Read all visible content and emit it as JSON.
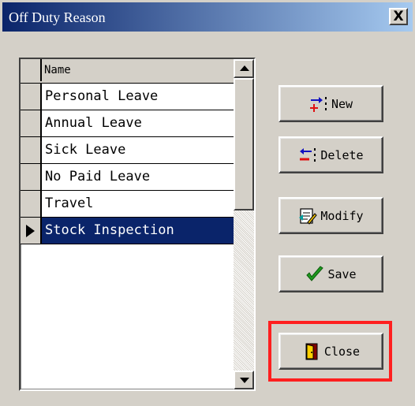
{
  "window": {
    "title": "Off Duty Reason",
    "close_glyph": "X"
  },
  "grid": {
    "column_header": "Name",
    "rows": [
      {
        "label": "Personal Leave",
        "selected": false
      },
      {
        "label": "Annual Leave",
        "selected": false
      },
      {
        "label": "Sick Leave",
        "selected": false
      },
      {
        "label": "No Paid Leave",
        "selected": false
      },
      {
        "label": "Travel",
        "selected": false
      },
      {
        "label": "Stock Inspection",
        "selected": true
      }
    ]
  },
  "buttons": {
    "new": {
      "label": "New",
      "icon": "add-record-icon"
    },
    "delete": {
      "label": "Delete",
      "icon": "delete-record-icon"
    },
    "modify": {
      "label": "Modify",
      "icon": "edit-document-icon"
    },
    "save": {
      "label": "Save",
      "icon": "checkmark-icon"
    },
    "close": {
      "label": "Close",
      "icon": "door-exit-icon"
    }
  },
  "colors": {
    "selection": "#0a246a",
    "highlight": "#ff1f1f",
    "face": "#d4d0c8"
  }
}
